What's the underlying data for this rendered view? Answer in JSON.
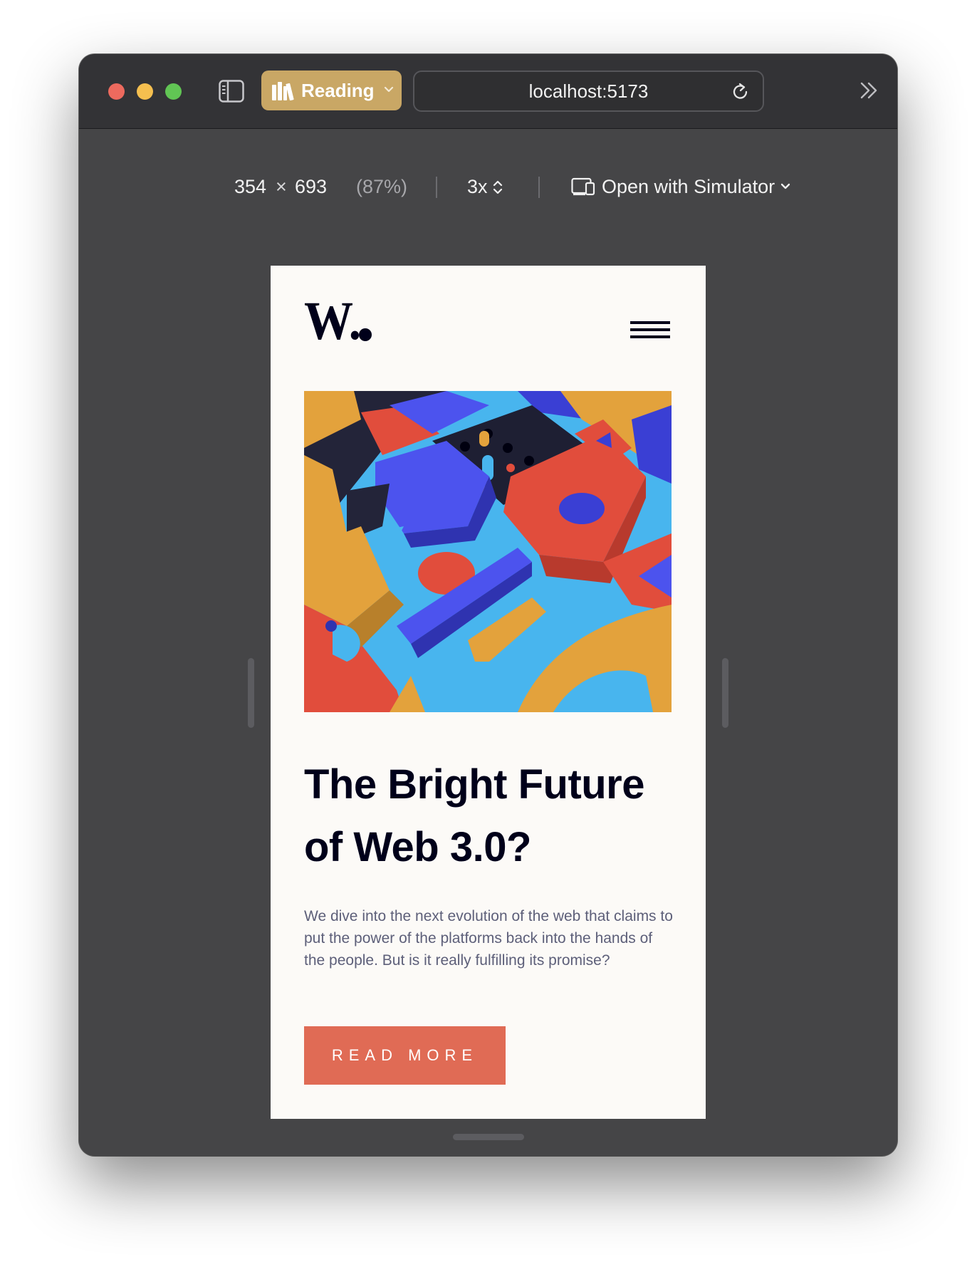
{
  "toolbar": {
    "reading_label": "Reading",
    "url": "localhost:5173",
    "colors": {
      "reading_bg": "#c9a765",
      "traffic_red": "#ed6a5e",
      "traffic_yellow": "#f5bf4f",
      "traffic_green": "#61c554"
    }
  },
  "device_bar": {
    "width": "354",
    "times": "×",
    "height": "693",
    "zoom": "(87%)",
    "scale": "3x",
    "simulator_label": "Open with Simulator"
  },
  "page": {
    "logo": "W.",
    "headline": "The Bright Future of Web 3.0?",
    "description": "We dive into the next evolution of the web that claims to put the power of the platforms back into the hands of the people. But is it really fulfilling its promise?",
    "cta_label": "READ MORE",
    "colors": {
      "background": "#fcfaf7",
      "headline": "#00001a",
      "text": "#5d5f79",
      "cta": "#e06b55"
    }
  }
}
